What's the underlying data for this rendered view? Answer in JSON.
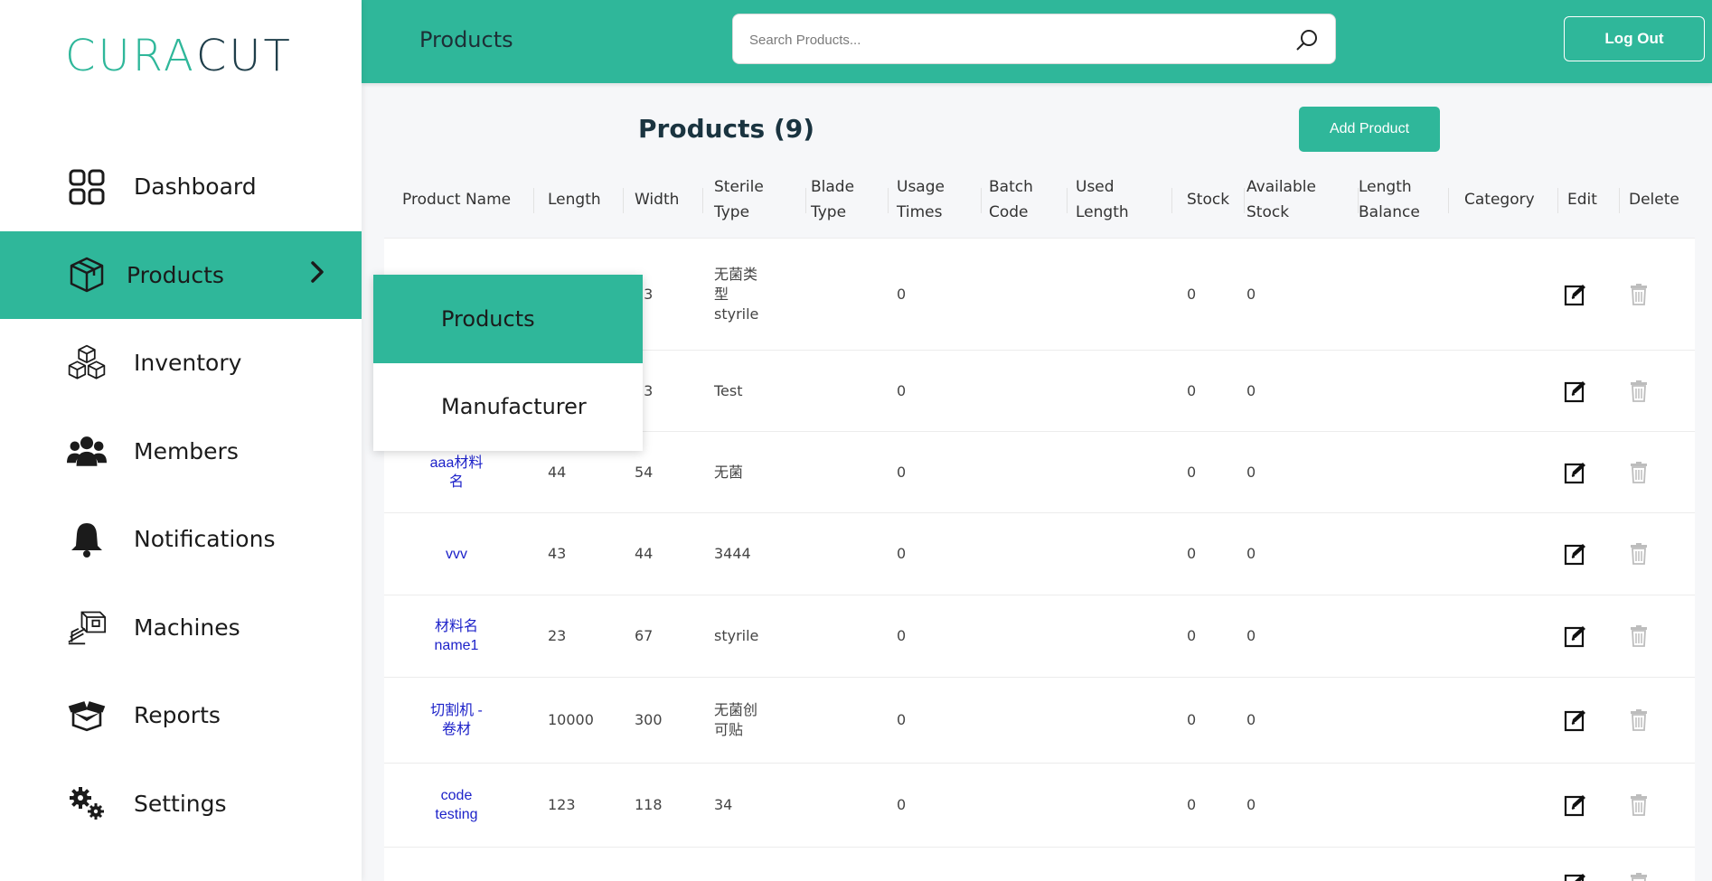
{
  "brand": {
    "logo_part1": "CURA",
    "logo_part2": "CUT",
    "accent_color": "#2fb79a",
    "dark_color": "#1f3e4a"
  },
  "sidebar": {
    "items": [
      {
        "label": "Dashboard",
        "icon": "dashboard-grid-icon"
      },
      {
        "label": "Products",
        "icon": "box-icon",
        "active": true
      },
      {
        "label": "Inventory",
        "icon": "boxes-icon"
      },
      {
        "label": "Members",
        "icon": "users-icon"
      },
      {
        "label": "Notifications",
        "icon": "bell-icon"
      },
      {
        "label": "Machines",
        "icon": "machine-icon"
      },
      {
        "label": "Reports",
        "icon": "open-box-icon"
      },
      {
        "label": "Settings",
        "icon": "gears-icon"
      }
    ]
  },
  "dropdown": {
    "items": [
      {
        "label": "Products",
        "active": true
      },
      {
        "label": "Manufacturer",
        "active": false
      }
    ]
  },
  "topbar": {
    "title": "Products",
    "search_placeholder": "Search Products...",
    "logout_label": "Log Out"
  },
  "main": {
    "heading": "Products (9)",
    "add_button": "Add Product"
  },
  "table": {
    "headers": {
      "name": "Product Name",
      "length": "Length",
      "width": "Width",
      "sterile": [
        "Sterile",
        "Type"
      ],
      "blade": [
        "Blade",
        "Type"
      ],
      "usage": [
        "Usage",
        "Times"
      ],
      "batch": [
        "Batch",
        "Code"
      ],
      "used": [
        "Used",
        "Length"
      ],
      "stock": "Stock",
      "available": [
        "Available",
        "Stock"
      ],
      "balance": [
        "Length",
        "Balance"
      ],
      "category": "Category",
      "edit": "Edit",
      "delete": "Delete"
    },
    "rows": [
      {
        "name": [],
        "length": "",
        "width": "23",
        "sterile": [
          "无菌类",
          "型",
          "styrile"
        ],
        "usage": "0",
        "stock": "0",
        "available": "0"
      },
      {
        "name": [],
        "length": "",
        "width": "23",
        "sterile": [
          "Test"
        ],
        "usage": "0",
        "stock": "0",
        "available": "0"
      },
      {
        "name": [
          "aaa材料",
          "名"
        ],
        "length": "44",
        "width": "54",
        "sterile": [
          "无菌"
        ],
        "usage": "0",
        "stock": "0",
        "available": "0"
      },
      {
        "name": [
          "vvv"
        ],
        "length": "43",
        "width": "44",
        "sterile": [
          "3444"
        ],
        "usage": "0",
        "stock": "0",
        "available": "0"
      },
      {
        "name": [
          "材料名",
          "name1"
        ],
        "length": "23",
        "width": "67",
        "sterile": [
          "styrile"
        ],
        "usage": "0",
        "stock": "0",
        "available": "0"
      },
      {
        "name": [
          "切割机 -",
          "卷材"
        ],
        "length": "10000",
        "width": "300",
        "sterile": [
          "无菌创",
          "可贴"
        ],
        "usage": "0",
        "stock": "0",
        "available": "0"
      },
      {
        "name": [
          "code",
          "testing"
        ],
        "length": "123",
        "width": "118",
        "sterile": [
          "34"
        ],
        "usage": "0",
        "stock": "0",
        "available": "0"
      },
      {
        "name": [],
        "length": "",
        "width": "",
        "sterile": [],
        "usage": "",
        "stock": "",
        "available": ""
      }
    ]
  }
}
